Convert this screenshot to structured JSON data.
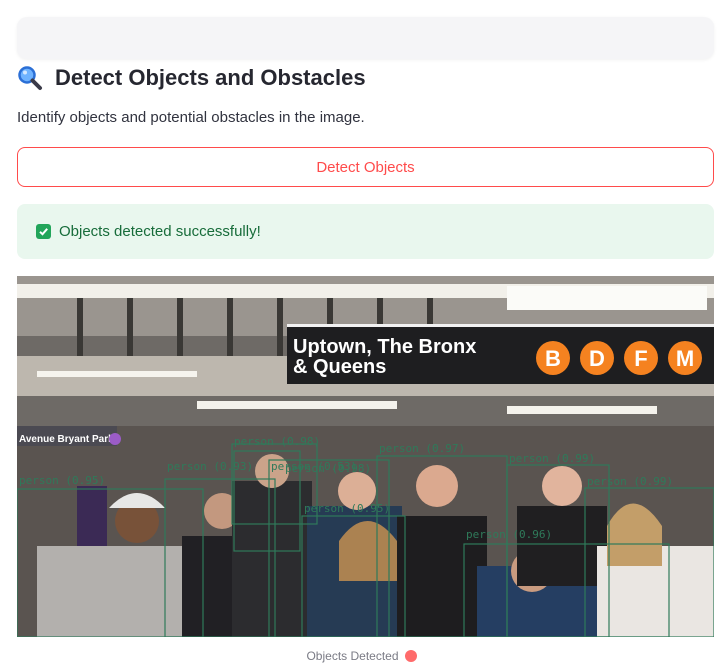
{
  "header": {
    "title": "Detect Objects and Obstacles",
    "icon": "magnifier-icon"
  },
  "subtitle": "Identify objects and potential obstacles in the image.",
  "detect_button": {
    "label": "Detect Objects"
  },
  "alert": {
    "text": "Objects detected successfully!",
    "status_color": "#22a55a"
  },
  "image": {
    "sign_text_line1": "Uptown, The Bronx",
    "sign_text_line2": "& Queens",
    "sign_letters": [
      "B",
      "D",
      "F",
      "M"
    ],
    "station_sign": "Avenue Bryant Park",
    "detections": [
      {
        "label": "person (0.95)"
      },
      {
        "label": "person (0.93)"
      },
      {
        "label": "person (0.98)"
      },
      {
        "label": "person (0.53)"
      },
      {
        "label": "person (0.97)"
      },
      {
        "label": "person (0.99)"
      },
      {
        "label": "person (0.99)"
      },
      {
        "label": "person (0.96)"
      },
      {
        "label": "person (0.95)"
      },
      {
        "label": "person (0.98)"
      }
    ]
  },
  "caption": {
    "text": "Objects Detected",
    "dot_color": "#ff6b6b"
  },
  "colors": {
    "accent": "#ff4b4b",
    "success_bg": "#e9f7ee",
    "box": "#2f7a5a"
  }
}
